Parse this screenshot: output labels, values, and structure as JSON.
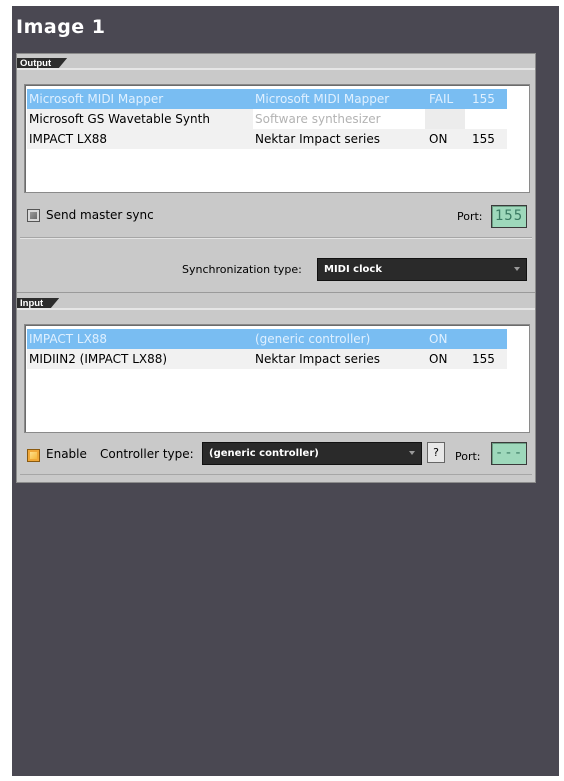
{
  "image_title": "Image 1",
  "output": {
    "section_label": "Output",
    "rows": [
      {
        "name": "Microsoft MIDI Mapper",
        "description": "Microsoft MIDI Mapper",
        "status": "FAIL",
        "port": "155",
        "selected": true
      },
      {
        "name": "Microsoft GS Wavetable Synth",
        "description": "Software synthesizer",
        "status": "",
        "port": "",
        "selected": false
      },
      {
        "name": "IMPACT LX88",
        "description": "Nektar Impact series",
        "status": "ON",
        "port": "155",
        "selected": false
      }
    ],
    "send_master_sync_label": "Send master sync",
    "send_master_sync_checked": true,
    "port_label": "Port:",
    "port_value": "155",
    "sync_type_label": "Synchronization type:",
    "sync_type_value": "MIDI clock"
  },
  "input": {
    "section_label": "Input",
    "rows": [
      {
        "name": "IMPACT LX88",
        "description": "(generic controller)",
        "status": "ON",
        "port": "",
        "selected": true
      },
      {
        "name": "MIDIIN2 (IMPACT LX88)",
        "description": "Nektar Impact series",
        "status": "ON",
        "port": "155",
        "selected": false
      }
    ],
    "enable_label": "Enable",
    "enable_checked": true,
    "controller_type_label": "Controller type:",
    "controller_type_value": "(generic controller)",
    "help_label": "?",
    "port_label": "Port:",
    "port_value": "---"
  },
  "colors": {
    "background": "#4a4852",
    "panel": "#c9c9c9",
    "selection": "#79bdf2",
    "lcd": "#9ed8bb",
    "enable_checkbox": "#f0a838"
  }
}
